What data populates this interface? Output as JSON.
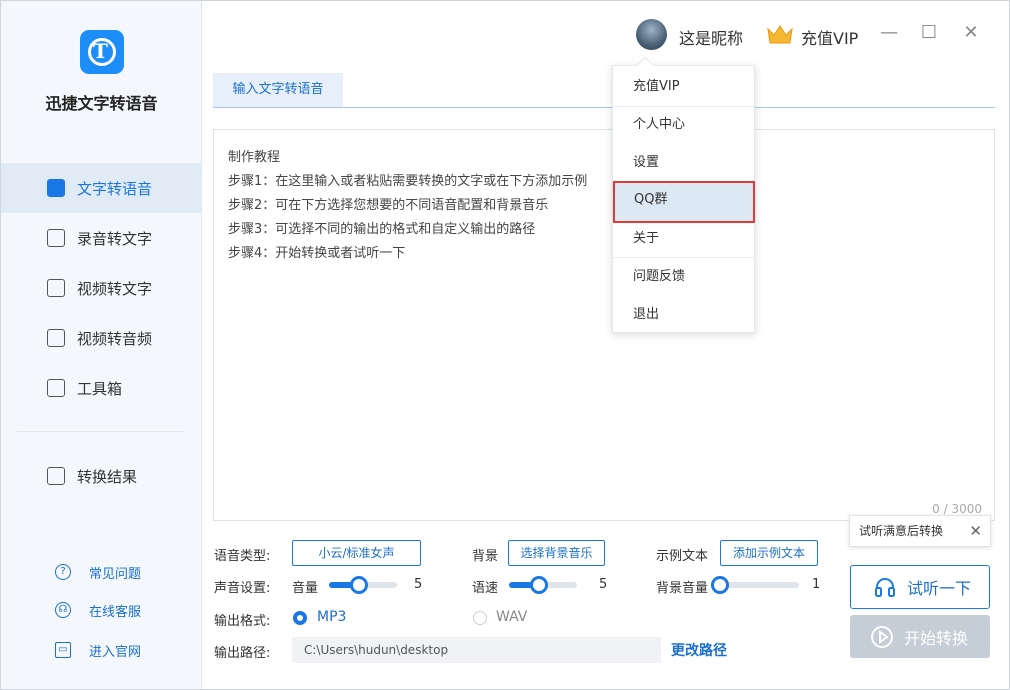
{
  "app": {
    "title": "迅捷文字转语音",
    "logo_letter": "T"
  },
  "topbar": {
    "nickname": "这是昵称",
    "vip_label": "充值VIP",
    "minimize": "—",
    "maximize": "☐",
    "close": "✕"
  },
  "sidebar": {
    "items": [
      {
        "label": "文字转语音",
        "icon": "text-to-speech-icon",
        "active": true
      },
      {
        "label": "录音转文字",
        "icon": "audio-to-text-icon"
      },
      {
        "label": "视频转文字",
        "icon": "video-to-text-icon"
      },
      {
        "label": "视频转音频",
        "icon": "video-to-audio-icon"
      },
      {
        "label": "工具箱",
        "icon": "toolbox-icon"
      },
      {
        "label": "转换结果",
        "icon": "results-icon"
      }
    ],
    "footer": [
      {
        "label": "常见问题",
        "icon": "question-icon",
        "glyph": "?"
      },
      {
        "label": "在线客服",
        "icon": "headset-icon",
        "glyph": "☊"
      },
      {
        "label": "进入官网",
        "icon": "website-icon",
        "glyph": "▭"
      }
    ]
  },
  "tab": {
    "label": "输入文字转语音"
  },
  "editor": {
    "lines": [
      "制作教程",
      "步骤1：在这里输入或者粘贴需要转换的文字或在下方添加示例",
      "步骤2：可在下方选择您想要的不同语音配置和背景音乐",
      "步骤3：可选择不同的输出的格式和自定义输出的路径",
      "步骤4：开始转换或者试听一下"
    ],
    "counter": "0 / 3000"
  },
  "menu": {
    "items": [
      "充值VIP",
      "个人中心",
      "设置",
      "QQ群",
      "关于",
      "问题反馈",
      "退出"
    ],
    "highlighted": "QQ群"
  },
  "settings": {
    "voice_type_label": "语音类型:",
    "voice_type_value": "小云/标准女声",
    "bg_label": "背景",
    "bg_button": "选择背景音乐",
    "sample_label": "示例文本",
    "sample_button": "添加示例文本",
    "sound_label": "声音设置:",
    "volume_label": "音量",
    "volume_value": "5",
    "speed_label": "语速",
    "speed_value": "5",
    "bg_volume_label": "背景音量",
    "bg_volume_value": "1",
    "format_label": "输出格式:",
    "format_mp3": "MP3",
    "format_wav": "WAV",
    "path_label": "输出路径:",
    "path_value": "C:\\Users\\hudun\\desktop",
    "change_path": "更改路径"
  },
  "actions": {
    "tooltip": "试听满意后转换",
    "tooltip_close": "✕",
    "listen": "试听一下",
    "start": "开始转换"
  },
  "colors": {
    "accent": "#1a78e6",
    "highlight_border": "#e53935",
    "disabled": "#c5cdd6"
  }
}
